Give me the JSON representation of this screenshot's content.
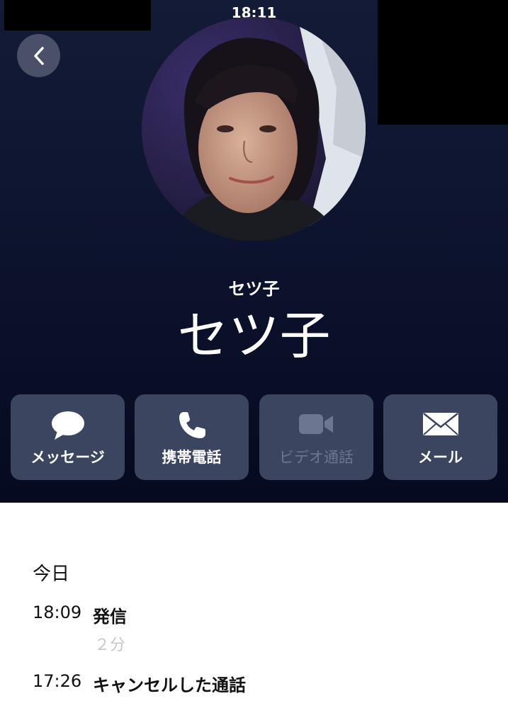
{
  "status": {
    "time": "18:11"
  },
  "contact": {
    "subtitle": "セツ子",
    "name": "セツ子"
  },
  "actions": [
    {
      "label": "メッセージ",
      "icon": "message-bubble-icon",
      "enabled": true
    },
    {
      "label": "携帯電話",
      "icon": "phone-icon",
      "enabled": true
    },
    {
      "label": "ビデオ通話",
      "icon": "video-camera-icon",
      "enabled": false
    },
    {
      "label": "メール",
      "icon": "mail-envelope-icon",
      "enabled": true
    }
  ],
  "history": {
    "section": "今日",
    "calls": [
      {
        "time": "18:09",
        "type": "発信",
        "duration": "２分"
      },
      {
        "time": "17:26",
        "type": "キャンセルした通話"
      }
    ]
  },
  "colors": {
    "header_bg": "#0e1530",
    "button_bg": "#3c4560",
    "disabled_text": "#6d7591"
  }
}
